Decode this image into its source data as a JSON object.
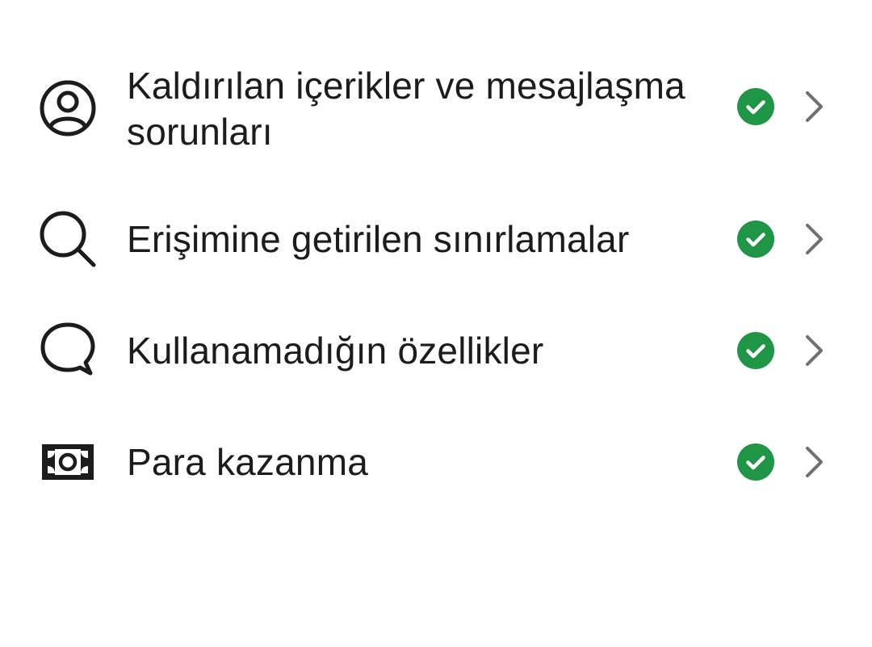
{
  "colors": {
    "text": "#1c1c1c",
    "status_ok": "#1e9646",
    "chevron": "#707070"
  },
  "items": [
    {
      "icon": "person-circle-icon",
      "label": "Kaldırılan içerikler ve mesajlaşma sorunları",
      "status": "check-circle-icon"
    },
    {
      "icon": "search-icon",
      "label": "Erişimine getirilen sınırlamalar",
      "status": "check-circle-icon"
    },
    {
      "icon": "chat-bubble-icon",
      "label": "Kullanamadığın özellikler",
      "status": "check-circle-icon"
    },
    {
      "icon": "money-icon",
      "label": "Para kazanma",
      "status": "check-circle-icon"
    }
  ]
}
